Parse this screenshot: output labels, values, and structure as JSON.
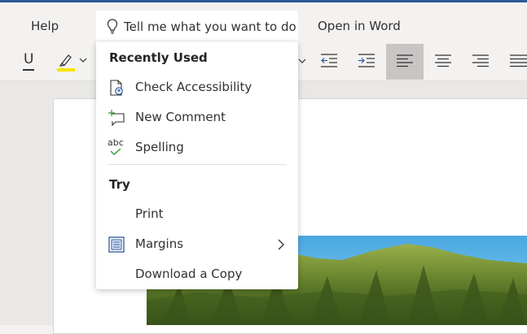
{
  "menubar": {
    "help": "Help",
    "tellme_placeholder": "Tell me what you want to do",
    "open_in_word": "Open in Word"
  },
  "ribbon": {
    "underline_glyph": "U"
  },
  "dropdown": {
    "recently_used_title": "Recently Used",
    "recent_items": [
      {
        "label": "Check Accessibility",
        "icon": "accessibility-icon"
      },
      {
        "label": "New Comment",
        "icon": "comment-add-icon"
      },
      {
        "label": "Spelling",
        "icon": "spelling-icon",
        "icon_text": "abc"
      }
    ],
    "try_title": "Try",
    "try_items": [
      {
        "label": "Print"
      },
      {
        "label": "Margins",
        "icon": "margins-icon",
        "has_submenu": true
      },
      {
        "label": "Download a Copy"
      }
    ]
  },
  "colors": {
    "accent": "#2b579a",
    "highlight": "#f7e600",
    "icon_green": "#3b9a3b",
    "icon_blue": "#2b579a"
  }
}
